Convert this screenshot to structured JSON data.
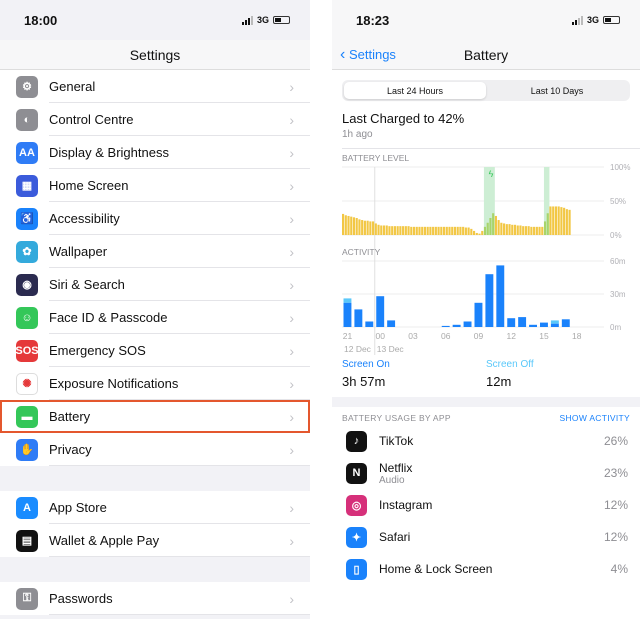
{
  "left": {
    "time": "18:00",
    "network": "3G",
    "title": "Settings",
    "groups": [
      [
        {
          "label": "General",
          "icon": "gear-icon",
          "color": "#8e8e93",
          "glyph": "⚙"
        },
        {
          "label": "Control Centre",
          "icon": "toggles-icon",
          "color": "#8e8e93",
          "glyph": "◐"
        },
        {
          "label": "Display & Brightness",
          "icon": "display-icon",
          "color": "#2f7cf6",
          "glyph": "AA"
        },
        {
          "label": "Home Screen",
          "icon": "home-screen-icon",
          "color": "#3b5bdb",
          "glyph": "▦"
        },
        {
          "label": "Accessibility",
          "icon": "accessibility-icon",
          "color": "#1a82fb",
          "glyph": "♿"
        },
        {
          "label": "Wallpaper",
          "icon": "wallpaper-icon",
          "color": "#34aadc",
          "glyph": "✿"
        },
        {
          "label": "Siri & Search",
          "icon": "siri-icon",
          "color": "#2b2b50",
          "glyph": "◉"
        },
        {
          "label": "Face ID & Passcode",
          "icon": "face-id-icon",
          "color": "#34c759",
          "glyph": "☺"
        },
        {
          "label": "Emergency SOS",
          "icon": "sos-icon",
          "color": "#e5393a",
          "glyph": "SOS"
        },
        {
          "label": "Exposure Notifications",
          "icon": "exposure-icon",
          "color": "#ffffff",
          "glyph": "✺"
        },
        {
          "label": "Battery",
          "icon": "battery-icon",
          "color": "#34c759",
          "glyph": "▬",
          "highlighted": true
        },
        {
          "label": "Privacy",
          "icon": "hand-icon",
          "color": "#2f7cf6",
          "glyph": "✋"
        }
      ],
      [
        {
          "label": "App Store",
          "icon": "app-store-icon",
          "color": "#1a8cff",
          "glyph": "A"
        },
        {
          "label": "Wallet & Apple Pay",
          "icon": "wallet-icon",
          "color": "#111111",
          "glyph": "▤"
        }
      ],
      [
        {
          "label": "Passwords",
          "icon": "key-icon",
          "color": "#8e8e93",
          "glyph": "⚿"
        }
      ]
    ]
  },
  "right": {
    "time": "18:23",
    "network": "3G",
    "back": "Settings",
    "title": "Battery",
    "tabs": [
      "Last 24 Hours",
      "Last 10 Days"
    ],
    "selected_tab": 0,
    "last_charged": "Last Charged to 42%",
    "last_charged_ago": "1h ago",
    "battery_label": "BATTERY LEVEL",
    "activity_label": "ACTIVITY",
    "battery_axis": [
      "100%",
      "50%",
      "0%"
    ],
    "activity_axis": [
      "60m",
      "30m",
      "0m"
    ],
    "x_ticks": [
      "21",
      "00",
      "03",
      "06",
      "09",
      "12",
      "15",
      "18"
    ],
    "dates": [
      "12 Dec",
      "13 Dec"
    ],
    "screen_on_label": "Screen On",
    "screen_on": "3h 57m",
    "screen_off_label": "Screen Off",
    "screen_off": "12m",
    "usage_label": "BATTERY USAGE BY APP",
    "show_activity": "SHOW ACTIVITY",
    "apps": [
      {
        "name": "TikTok",
        "sub": "",
        "pct": "26%",
        "icon": "tiktok-icon",
        "color": "#111111",
        "glyph": "♪"
      },
      {
        "name": "Netflix",
        "sub": "Audio",
        "pct": "23%",
        "icon": "netflix-icon",
        "color": "#111111",
        "glyph": "N"
      },
      {
        "name": "Instagram",
        "sub": "",
        "pct": "12%",
        "icon": "instagram-icon",
        "color": "#d6307a",
        "glyph": "◎"
      },
      {
        "name": "Safari",
        "sub": "",
        "pct": "12%",
        "icon": "safari-icon",
        "color": "#1a82fb",
        "glyph": "✦"
      },
      {
        "name": "Home & Lock Screen",
        "sub": "",
        "pct": "4%",
        "icon": "home-lock-icon",
        "color": "#1a82fb",
        "glyph": "▯"
      }
    ],
    "colors": {
      "battery": "#f2c744",
      "charging": "#34c759",
      "activity": "#1a82fb",
      "activity_light": "#5ac8fa",
      "accent": "#1a82fb"
    }
  },
  "chart_data": [
    {
      "type": "bar",
      "title": "BATTERY LEVEL",
      "x_start": "21:00",
      "step_minutes": 15,
      "ylim": [
        0,
        100
      ],
      "values": [
        31,
        29,
        28,
        27,
        26,
        25,
        23,
        22,
        21,
        21,
        20,
        20,
        17,
        15,
        14,
        14,
        14,
        13,
        13,
        13,
        13,
        13,
        13,
        13,
        13,
        12,
        12,
        12,
        12,
        12,
        12,
        12,
        12,
        12,
        12,
        12,
        12,
        12,
        12,
        12,
        12,
        12,
        12,
        12,
        12,
        11,
        11,
        9,
        6,
        3,
        2,
        6,
        12,
        18,
        25,
        32,
        28,
        22,
        18,
        17,
        16,
        16,
        15,
        15,
        14,
        14,
        13,
        13,
        13,
        12,
        12,
        12,
        12,
        12,
        20,
        32,
        42,
        42,
        42,
        42,
        41,
        40,
        38,
        37
      ],
      "charging": [
        [
          "10:00",
          "11:00"
        ],
        [
          "15:30",
          "16:00"
        ]
      ]
    },
    {
      "type": "bar",
      "title": "ACTIVITY",
      "categories": [
        "21",
        "22",
        "23",
        "00",
        "01",
        "02",
        "03",
        "04",
        "05",
        "06",
        "07",
        "08",
        "09",
        "10",
        "11",
        "12",
        "13",
        "14",
        "15",
        "16",
        "17"
      ],
      "series": [
        {
          "name": "Screen On",
          "values": [
            22,
            16,
            5,
            28,
            6,
            0,
            0,
            0,
            0,
            1,
            2,
            5,
            22,
            48,
            56,
            8,
            9,
            2,
            4,
            3,
            7
          ]
        },
        {
          "name": "Screen Off",
          "values": [
            4,
            0,
            0,
            0,
            0,
            0,
            0,
            0,
            0,
            0,
            0,
            0,
            0,
            0,
            0,
            0,
            0,
            0,
            0,
            3,
            0
          ]
        }
      ],
      "ylim": [
        0,
        60
      ]
    }
  ]
}
